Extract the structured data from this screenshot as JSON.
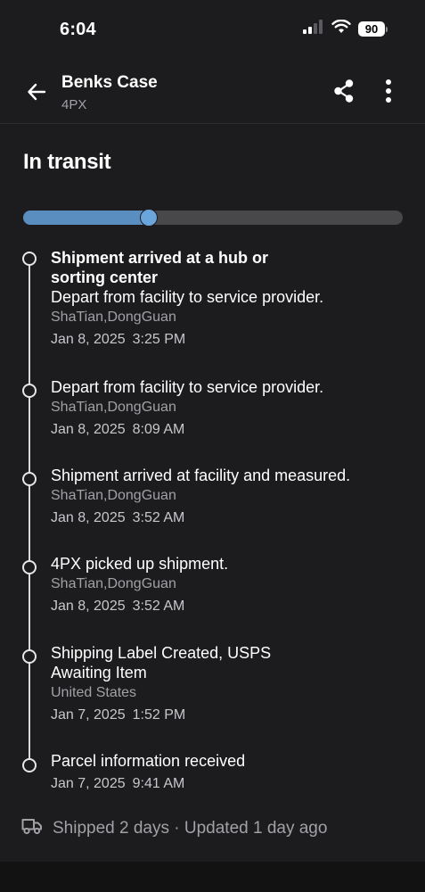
{
  "status_bar": {
    "time": "6:04",
    "battery": "90"
  },
  "header": {
    "title": "Benks Case",
    "subtitle": "4PX"
  },
  "shipment": {
    "status": "In transit",
    "progress_fraction": 0.33,
    "accent_color": "#5b8ec0"
  },
  "events": [
    {
      "title": "Shipment arrived at a hub or sorting center",
      "description": "Depart from facility to service provider.",
      "location": "ShaTian,DongGuan",
      "date": "Jan 8, 2025",
      "time": "3:25 PM"
    },
    {
      "title": "Depart from facility to service provider.",
      "location": "ShaTian,DongGuan",
      "date": "Jan 8, 2025",
      "time": "8:09 AM"
    },
    {
      "title": "Shipment arrived at facility and measured.",
      "location": "ShaTian,DongGuan",
      "date": "Jan 8, 2025",
      "time": "3:52 AM"
    },
    {
      "title": "4PX picked up shipment.",
      "location": "ShaTian,DongGuan",
      "date": "Jan 8, 2025",
      "time": "3:52 AM"
    },
    {
      "title": "Shipping Label Created, USPS Awaiting Item",
      "location": "United States",
      "date": "Jan 7, 2025",
      "time": "1:52 PM"
    },
    {
      "title": "Parcel information received",
      "date": "Jan 7, 2025",
      "time": "9:41 AM"
    }
  ],
  "footer": {
    "summary": "Shipped 2 days · Updated 1 day ago",
    "icon": "truck-icon"
  },
  "icons": {
    "back": "arrow-left-icon",
    "share": "share-icon",
    "more": "more-vertical-icon",
    "signal": "cellular-signal-icon",
    "wifi": "wifi-icon",
    "battery": "battery-icon"
  }
}
